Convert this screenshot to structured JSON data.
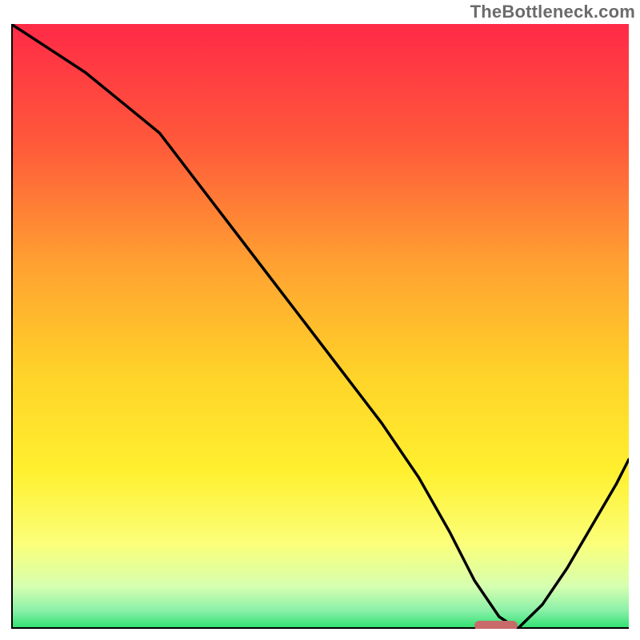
{
  "watermark": "TheBottleneck.com",
  "chart_data": {
    "type": "line",
    "title": "",
    "xlabel": "",
    "ylabel": "",
    "xlim": [
      0,
      100
    ],
    "ylim": [
      0,
      100
    ],
    "grid": false,
    "legend": false,
    "background_gradient_stops": [
      {
        "offset": 0.0,
        "color": "#ff2a47"
      },
      {
        "offset": 0.2,
        "color": "#ff5a3a"
      },
      {
        "offset": 0.4,
        "color": "#ffa231"
      },
      {
        "offset": 0.58,
        "color": "#ffd329"
      },
      {
        "offset": 0.74,
        "color": "#fff02f"
      },
      {
        "offset": 0.86,
        "color": "#fbff7a"
      },
      {
        "offset": 0.93,
        "color": "#d6ffb0"
      },
      {
        "offset": 0.97,
        "color": "#8af0a8"
      },
      {
        "offset": 1.0,
        "color": "#2be06e"
      }
    ],
    "series": [
      {
        "name": "bottleneck-curve",
        "color": "#000000",
        "x": [
          0,
          6,
          12,
          18,
          24,
          30,
          36,
          42,
          48,
          54,
          60,
          66,
          71,
          75,
          79,
          82,
          86,
          90,
          94,
          98,
          100
        ],
        "y": [
          100,
          96,
          92,
          87,
          82,
          74,
          66,
          58,
          50,
          42,
          34,
          25,
          16,
          8,
          2,
          0,
          4,
          10,
          17,
          24,
          28
        ]
      }
    ],
    "marker": {
      "name": "optimal-marker",
      "color": "#c96a6a",
      "x_start": 75,
      "x_end": 82,
      "y": 0
    }
  }
}
